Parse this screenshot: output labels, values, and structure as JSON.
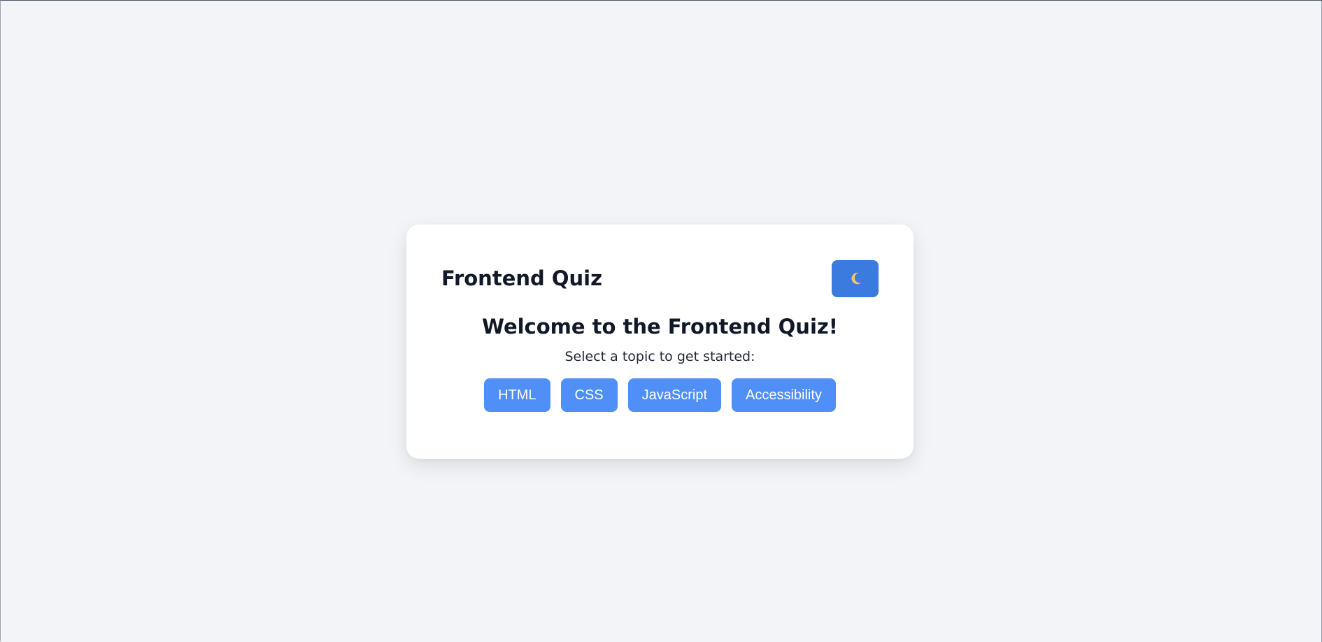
{
  "header": {
    "title": "Frontend Quiz",
    "theme_toggle_icon": "moon-icon"
  },
  "welcome": {
    "title": "Welcome to the Frontend Quiz!",
    "subtitle": "Select a topic to get started:"
  },
  "topics": [
    {
      "label": "HTML"
    },
    {
      "label": "CSS"
    },
    {
      "label": "JavaScript"
    },
    {
      "label": "Accessibility"
    }
  ],
  "colors": {
    "background": "#f2f4f7",
    "card": "#ffffff",
    "toggle": "#3b7be0",
    "topic_button": "#4f8ff7",
    "moon": "#f5c26b"
  }
}
